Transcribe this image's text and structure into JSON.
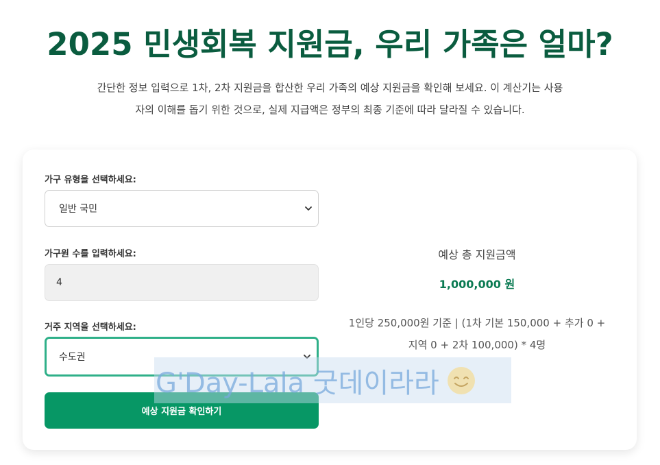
{
  "header": {
    "title": "2025 민생회복 지원금, 우리 가족은 얼마?",
    "description_line1": "간단한 정보 입력으로 1차, 2차 지원금을 합산한 우리 가족의 예상 지원금을 확인해 보세요. 이 계산기는 사용",
    "description_line2": "자의 이해를 돕기 위한 것으로, 실제 지급액은 정부의 최종 기준에 따라 달라질 수 있습니다."
  },
  "form": {
    "household_type_label": "가구 유형을 선택하세요:",
    "household_type_value": "일반 국민",
    "members_label": "가구원 수를 입력하세요:",
    "members_value": "4",
    "region_label": "거주 지역을 선택하세요:",
    "region_value": "수도권",
    "submit_label": "예상 지원금 확인하기"
  },
  "result": {
    "label": "예상 총 지원금액",
    "amount": "1,000,000 원",
    "detail_line1": "1인당 250,000원 기준 | (1차 기본 150,000 + 추가 0 +",
    "detail_line2": "지역 0 + 2차 100,000) * 4명"
  },
  "watermark": {
    "text": "G'Day-Lala 굿데이라라",
    "icon": "smile-emoji-icon"
  },
  "colors": {
    "title": "#0a5c3f",
    "accent": "#079765",
    "focus_border": "#2fb089",
    "amount": "#0a7a52"
  }
}
